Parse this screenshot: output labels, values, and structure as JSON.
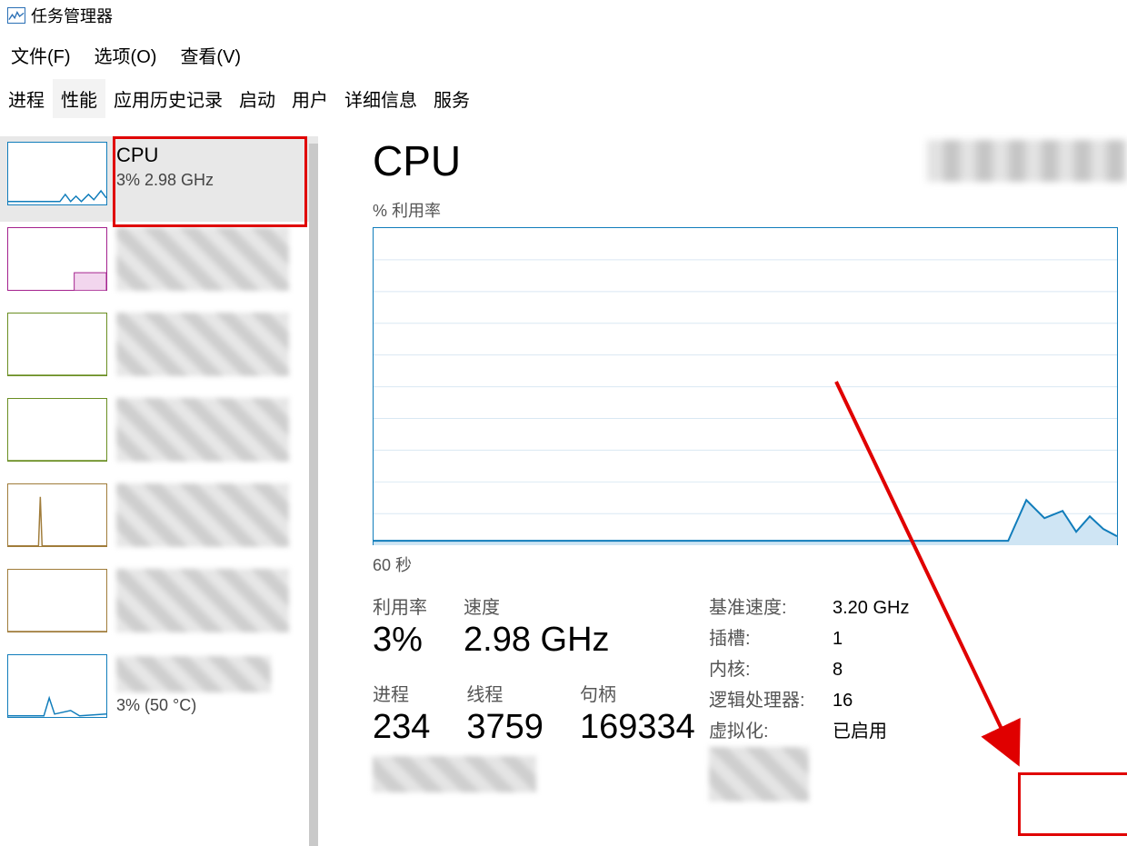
{
  "app": {
    "title": "任务管理器"
  },
  "menu": {
    "file": "文件(F)",
    "options": "选项(O)",
    "view": "查看(V)"
  },
  "tabs": {
    "processes": "进程",
    "performance": "性能",
    "app_history": "应用历史记录",
    "startup": "启动",
    "users": "用户",
    "details": "详细信息",
    "services": "服务"
  },
  "sidebar": {
    "cpu": {
      "title": "CPU",
      "sub": "3%  2.98 GHz"
    },
    "gpu_sub": "3%  (50 °C)"
  },
  "main": {
    "title": "CPU",
    "util_label": "% 利用率",
    "x_label": "60 秒",
    "stats": {
      "util_label": "利用率",
      "util_value": "3%",
      "speed_label": "速度",
      "speed_value": "2.98 GHz",
      "proc_label": "进程",
      "proc_value": "234",
      "thread_label": "线程",
      "thread_value": "3759",
      "handle_label": "句柄",
      "handle_value": "169334"
    },
    "kv": {
      "base_speed_k": "基准速度:",
      "base_speed_v": "3.20 GHz",
      "sockets_k": "插槽:",
      "sockets_v": "1",
      "cores_k": "内核:",
      "cores_v": "8",
      "logical_k": "逻辑处理器:",
      "logical_v": "16",
      "virt_k": "虚拟化:",
      "virt_v": "已启用"
    }
  },
  "chart_data": {
    "type": "line",
    "title": "% 利用率",
    "xlabel": "60 秒",
    "ylabel": "",
    "ylim": [
      0,
      100
    ],
    "x_range_seconds": 60,
    "series": [
      {
        "name": "CPU %",
        "values": [
          2,
          2,
          2,
          2,
          2,
          2,
          2,
          2,
          2,
          2,
          2,
          2,
          2,
          2,
          2,
          2,
          2,
          2,
          2,
          2,
          2,
          2,
          2,
          2,
          2,
          2,
          2,
          2,
          2,
          2,
          2,
          2,
          2,
          2,
          2,
          2,
          2,
          2,
          2,
          2,
          2,
          2,
          2,
          2,
          2,
          2,
          2,
          2,
          2,
          2,
          2,
          3,
          14,
          10,
          6,
          8,
          5,
          7,
          4,
          3
        ]
      }
    ]
  }
}
